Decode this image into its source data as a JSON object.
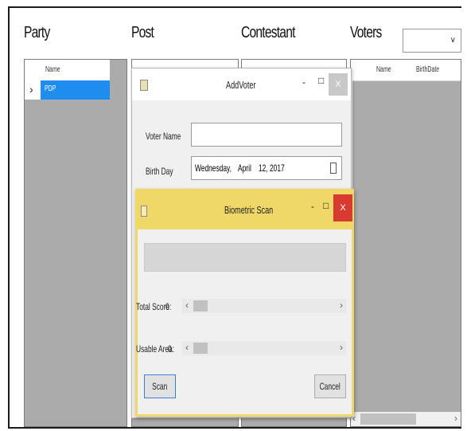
{
  "headers": {
    "party": "Party",
    "post": "Post",
    "contestant": "Contestant",
    "voters": "Voters"
  },
  "voters_dropdown": {
    "value": "",
    "arrow": "∨"
  },
  "party_grid": {
    "col_name": "Name",
    "selected_row": "PDP",
    "row_marker": "›"
  },
  "voters_grid": {
    "col_name": "Name",
    "col_birthdate": "BirthDate"
  },
  "add_voter": {
    "title": "AddVoter",
    "voter_name_label": "Voter Name",
    "voter_name_value": "",
    "birthday_label": "Birth Day",
    "birthday_day": "Wednesday,",
    "birthday_month": "April",
    "birthday_date": "12, 2017",
    "minimize": "-",
    "maximize": "□",
    "close": "X"
  },
  "biometric": {
    "title": "Biometric Scan",
    "total_score_label": "Total Score:",
    "total_score_value": "0",
    "usable_area_label": "Usable Area:",
    "usable_area_value": "0",
    "scan_button": "Scan",
    "cancel_button": "Cancel",
    "minimize": "-",
    "maximize": "□",
    "close": "X",
    "left_arrow": "‹",
    "right_arrow": "›"
  },
  "colors": {
    "accent_title": "#f0d868",
    "close_red": "#d93a2f",
    "selected_row": "#1f8cf0",
    "grid_bg": "#ababab"
  }
}
